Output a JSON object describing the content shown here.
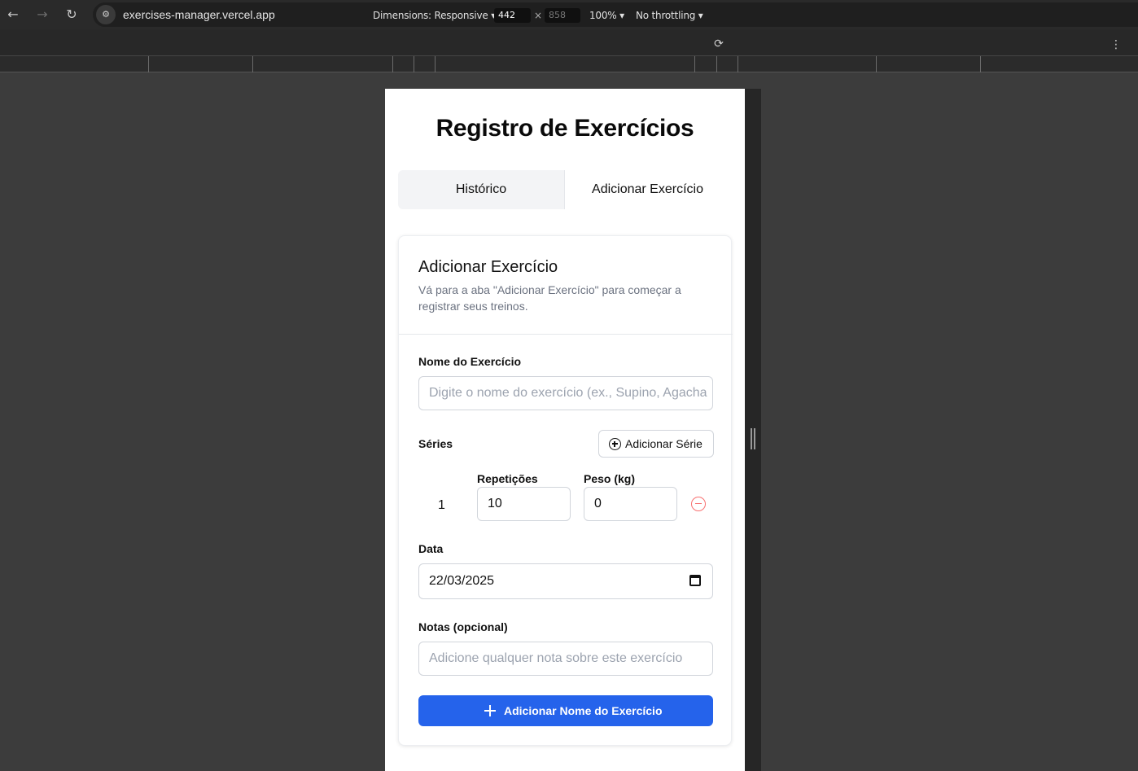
{
  "browser": {
    "url": "exercises-manager.vercel.app",
    "devtools": {
      "dimensions_label": "Dimensions: Responsive",
      "width": "442",
      "height": "858",
      "zoom": "100%",
      "throttling": "No throttling"
    }
  },
  "page": {
    "title": "Registro de Exercícios",
    "tabs": [
      {
        "label": "Histórico"
      },
      {
        "label": "Adicionar Exercício"
      }
    ],
    "card": {
      "title": "Adicionar Exercício",
      "description": "Vá para a aba \"Adicionar Exercício\" para começar a registrar seus treinos."
    },
    "form": {
      "exercise_name_label": "Nome do Exercício",
      "exercise_name_placeholder": "Digite o nome do exercício (ex., Supino, Agacha",
      "series_label": "Séries",
      "add_series_button": "Adicionar Série",
      "reps_label": "Repetições",
      "weight_label": "Peso (kg)",
      "sets": [
        {
          "number": "1",
          "reps": "10",
          "weight": "0"
        }
      ],
      "date_label": "Data",
      "date_value": "22/03/2025",
      "notes_label": "Notas (opcional)",
      "notes_placeholder": "Adicione qualquer nota sobre este exercício",
      "submit_button": "Adicionar Nome do Exercício"
    }
  },
  "colors": {
    "primary": "#2563eb",
    "danger": "#f87171"
  }
}
